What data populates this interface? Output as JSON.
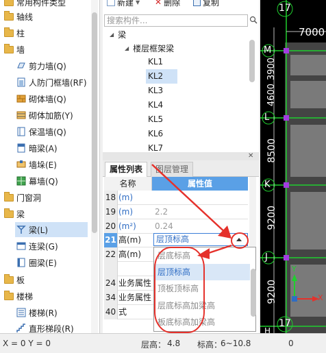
{
  "left_tree": {
    "items": [
      {
        "type": "folder",
        "label": "常用构件类型",
        "icon": "folder-icon"
      },
      {
        "type": "folder",
        "label": "轴线",
        "icon": "folder-icon"
      },
      {
        "type": "folder",
        "label": "柱",
        "icon": "folder-icon"
      },
      {
        "type": "folder",
        "label": "墙",
        "icon": "folder-icon"
      },
      {
        "type": "item",
        "label": "剪力墙(Q)",
        "icon": "shear-wall-icon"
      },
      {
        "type": "item",
        "label": "人防门框墙(RF)",
        "icon": "civil-defense-door-icon"
      },
      {
        "type": "item",
        "label": "砌体墙(Q)",
        "icon": "masonry-wall-icon"
      },
      {
        "type": "item",
        "label": "砌体加筋(Y)",
        "icon": "masonry-rebar-icon"
      },
      {
        "type": "item",
        "label": "保温墙(Q)",
        "icon": "insulation-wall-icon"
      },
      {
        "type": "item",
        "label": "暗梁(A)",
        "icon": "hidden-beam-icon"
      },
      {
        "type": "item",
        "label": "墙垛(E)",
        "icon": "wall-pier-icon"
      },
      {
        "type": "item",
        "label": "幕墙(Q)",
        "icon": "curtain-wall-icon"
      },
      {
        "type": "folder",
        "label": "门窗洞",
        "icon": "folder-icon"
      },
      {
        "type": "folder",
        "label": "梁",
        "icon": "folder-icon"
      },
      {
        "type": "item",
        "label": "梁(L)",
        "icon": "beam-icon",
        "selected": true
      },
      {
        "type": "item",
        "label": "连梁(G)",
        "icon": "coupling-beam-icon"
      },
      {
        "type": "item",
        "label": "圈梁(E)",
        "icon": "ring-beam-icon"
      },
      {
        "type": "folder",
        "label": "板",
        "icon": "folder-icon"
      },
      {
        "type": "folder",
        "label": "楼梯",
        "icon": "folder-icon"
      },
      {
        "type": "item",
        "label": "楼梯(R)",
        "icon": "stair-icon"
      },
      {
        "type": "item",
        "label": "直形梯段(R)",
        "icon": "straight-flight-icon"
      }
    ]
  },
  "toolbar": {
    "new_label": "新建",
    "delete_label": "删除",
    "copy_label": "复制"
  },
  "search": {
    "placeholder": "搜索构件..."
  },
  "component_tree": {
    "root": "梁",
    "group": "楼层框架梁",
    "items": [
      "KL1",
      "KL2",
      "KL3",
      "KL4",
      "KL5",
      "KL6",
      "KL7"
    ],
    "selected": "KL2"
  },
  "property_panel": {
    "tabs": [
      "属性列表",
      "图层管理"
    ],
    "col_name": "名称",
    "col_value": "属性值",
    "rows": [
      {
        "num": "18",
        "name": "(m)",
        "value": ""
      },
      {
        "num": "19",
        "name": "(m)",
        "value": "2.2"
      },
      {
        "num": "20",
        "name": "(m²)",
        "value": "0.24"
      },
      {
        "num": "21",
        "name": "高(m)",
        "value": "层顶标高"
      },
      {
        "num": "22",
        "name": "高(m)",
        "value": ""
      },
      {
        "num": "24",
        "name": "业务属性",
        "value": ""
      },
      {
        "num": "34",
        "name": "业务属性",
        "value": ""
      },
      {
        "num": "40",
        "name": "式",
        "value": ""
      }
    ],
    "dropdown_options": [
      "层底标高",
      "层顶标高",
      "顶板顶标高",
      "层底标高加梁高",
      "板底标高加梁高"
    ],
    "dropdown_highlight": "层顶标高"
  },
  "canvas": {
    "labels": [
      "17",
      "7000",
      "M",
      "3900",
      "4600",
      "L",
      "8500",
      "K",
      "9200",
      "J",
      "9200",
      "17",
      "H"
    ],
    "axis_y": "Y",
    "axis_x": "X"
  },
  "status_bar": {
    "coords": "X = 0 Y = 0",
    "floor_height_label": "层高：",
    "floor_height": "4.8",
    "elevation_label": "标高：",
    "elevation": "6~10.8",
    "extra": "0"
  },
  "colors": {
    "accent": "#5aa0e6",
    "annotation": "#e5312b",
    "canvas_bg": "#000000",
    "grid_line": "#1fcf2e",
    "purple": "#a23de0"
  }
}
